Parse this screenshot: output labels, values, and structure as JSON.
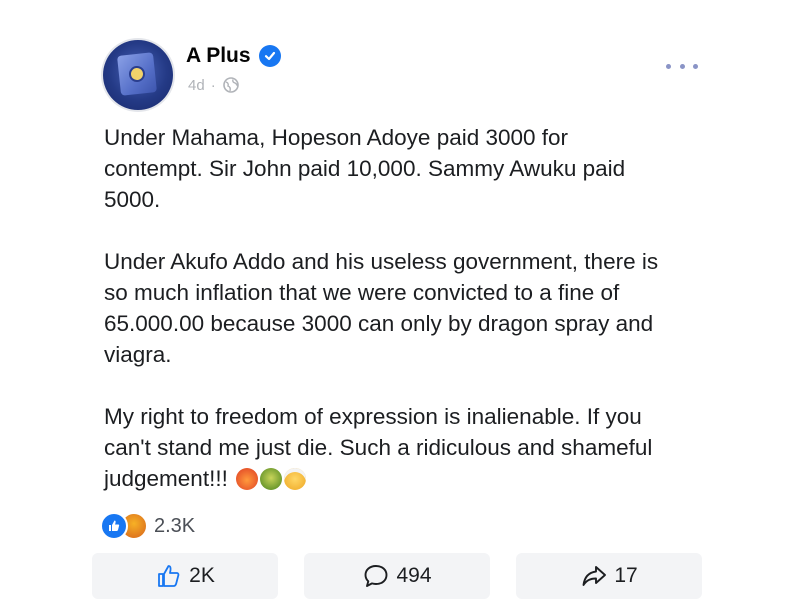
{
  "post": {
    "author": "A Plus",
    "verified": true,
    "time": "4d",
    "separator": "·",
    "audience_icon": "globe-icon",
    "more_icon": "more-options-icon",
    "paragraphs": [
      "Under Mahama, Hopeson Adoye paid 3000 for\ncontempt. Sir John paid 10,000. Sammy Awuku paid\n5000.",
      "Under Akufo Addo and his useless government, there is\nso much inflation that we were convicted to a fine of\n65.000.00 because 3000 can only by dragon spray and\nviagra.",
      "My right to freedom of expression is inalienable. If you\ncan't stand me just die. Such a ridiculous and shameful\njudgement!!!"
    ],
    "trailing_emojis": [
      "rage-emoji",
      "vomit-emoji",
      "shocked-emoji"
    ]
  },
  "reactions": {
    "icons": [
      "like-reaction-icon",
      "care-reaction-icon"
    ],
    "count": "2.3K"
  },
  "actions": {
    "like_count": "2K",
    "comment_count": "494",
    "share_count": "17"
  },
  "colors": {
    "brand_blue": "#1877f2",
    "text": "#1c1e21",
    "muted": "#b0b3b8",
    "action_bg": "#f3f4f6"
  }
}
